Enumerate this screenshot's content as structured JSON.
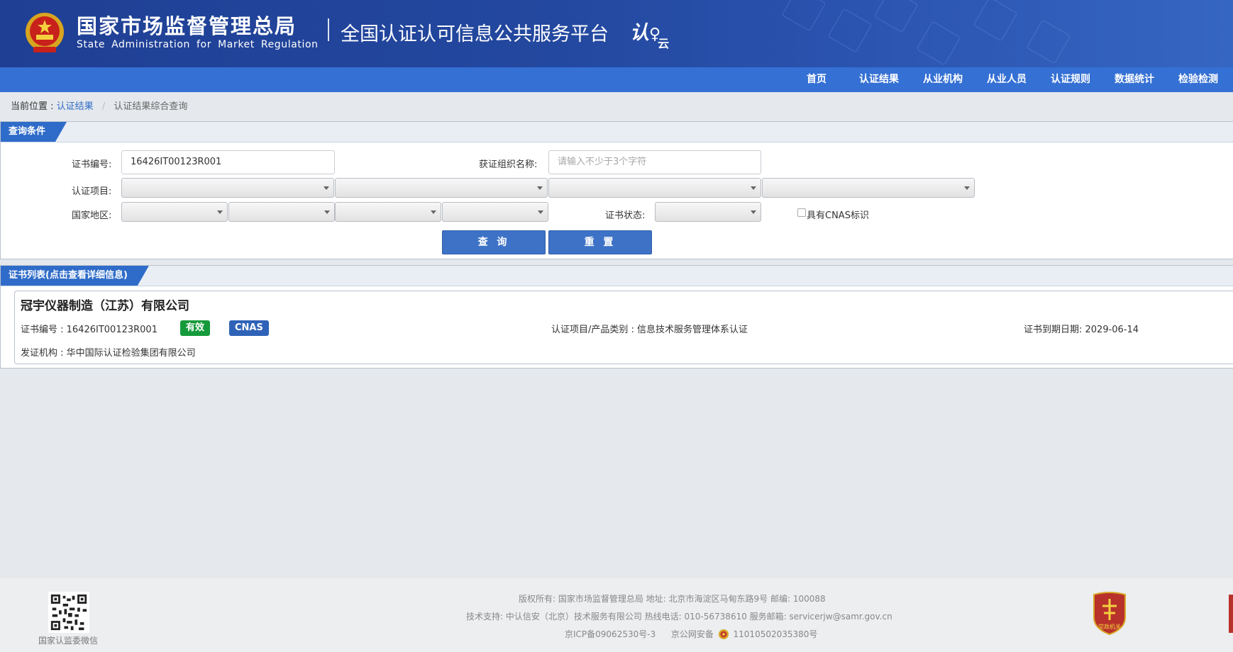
{
  "header": {
    "org_cn": "国家市场监督管理总局",
    "org_en": "State Administration for Market Regulation",
    "platform": "全国认证认可信息公共服务平台",
    "brand_a": "认",
    "brand_b": "云"
  },
  "nav": {
    "items": [
      "首页",
      "认证结果",
      "从业机构",
      "从业人员",
      "认证规则",
      "数据统计",
      "检验检测"
    ]
  },
  "breadcrumb": {
    "prefix": "当前位置 :",
    "link": "认证结果",
    "separator": "/",
    "current": "认证结果综合查询"
  },
  "query": {
    "panel_title": "查询条件",
    "cert_no_label": "证书编号:",
    "cert_no_value": "16426IT00123R001",
    "org_name_label": "获证组织名称:",
    "org_name_placeholder": "请输入不少于3个字符",
    "project_label": "认证项目:",
    "region_label": "国家地区:",
    "status_label": "证书状态:",
    "cnas_label": "具有CNAS标识",
    "search_button": "查 询",
    "reset_button": "重 置"
  },
  "results": {
    "panel_title": "证书列表(点击查看详细信息)",
    "items": [
      {
        "company": "冠宇仪器制造（江苏）有限公司",
        "cert_no": "证书编号 : 16426IT00123R001",
        "status_badge": "有效",
        "cnas_badge": "CNAS",
        "project": "认证项目/产品类别 : 信息技术服务管理体系认证",
        "expiry": "证书到期日期: 2029-06-14",
        "issuer": "发证机构 : 华中国际认证检验集团有限公司"
      }
    ]
  },
  "footer": {
    "qr_caption": "国家认监委微信",
    "line1": "版权所有:  国家市场监督管理总局    地址:  北京市海淀区马甸东路9号    邮编:  100088",
    "line2": "技术支持:  中认信安（北京）技术服务有限公司    热线电话:  010-56738610    服务邮箱:  servicerjw@samr.gov.cn",
    "line3a": "京ICP备09062530号-3",
    "line3b": "京公网安备",
    "line3c": "11010502035380号",
    "party_logo_text": "党政机关"
  },
  "colors": {
    "header_bg": "#23489f",
    "nav_bg": "#3570d4",
    "panel_tab": "#2f6cc9",
    "button": "#3d72c6",
    "badge_valid": "#159a3b",
    "badge_cnas": "#2f63b8"
  }
}
